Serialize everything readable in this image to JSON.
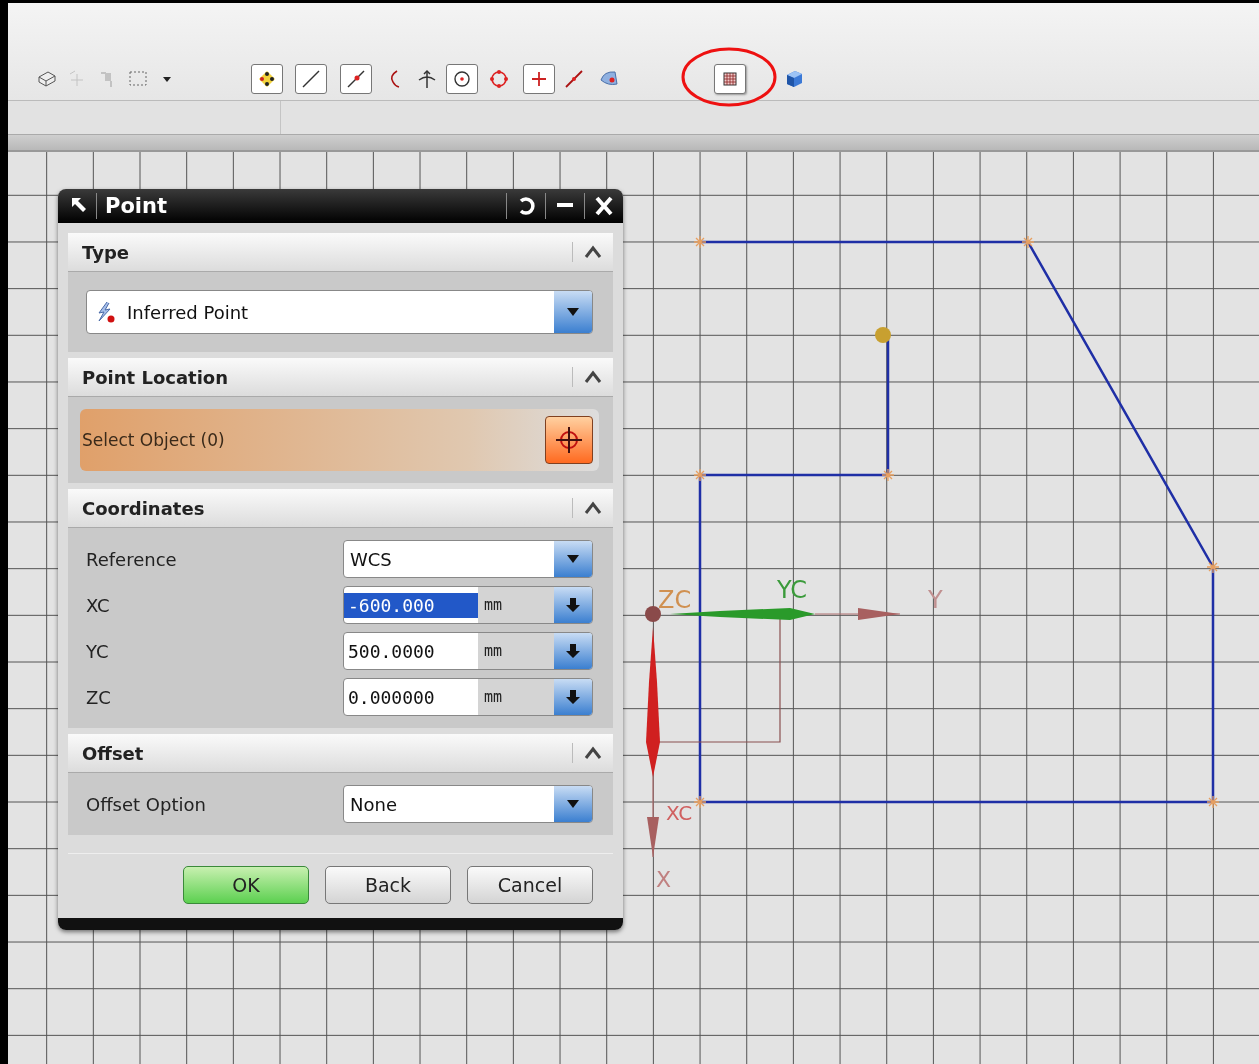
{
  "toolbar": {
    "buttons": [
      {
        "kind": "solid",
        "on": false,
        "disabled": false,
        "annotated": false
      },
      {
        "kind": "point-move",
        "on": false,
        "disabled": true,
        "annotated": false
      },
      {
        "kind": "pin",
        "on": false,
        "disabled": true,
        "annotated": false
      },
      {
        "kind": "select-box",
        "on": false,
        "disabled": false,
        "annotated": false
      },
      {
        "kind": "caret",
        "on": false,
        "disabled": false,
        "annotated": false
      },
      {
        "kind": "snap",
        "on": true,
        "disabled": false,
        "annotated": false
      },
      {
        "kind": "line",
        "on": true,
        "disabled": false,
        "annotated": false
      },
      {
        "kind": "endpoint",
        "on": true,
        "disabled": false,
        "annotated": false
      },
      {
        "kind": "arc",
        "on": false,
        "disabled": false,
        "annotated": false
      },
      {
        "kind": "intersect",
        "on": false,
        "disabled": false,
        "annotated": false
      },
      {
        "kind": "center",
        "on": true,
        "disabled": false,
        "annotated": false
      },
      {
        "kind": "quadrant",
        "on": false,
        "disabled": false,
        "annotated": false
      },
      {
        "kind": "plus",
        "on": true,
        "disabled": false,
        "annotated": false
      },
      {
        "kind": "segment",
        "on": false,
        "disabled": false,
        "annotated": false
      },
      {
        "kind": "face",
        "on": false,
        "disabled": false,
        "annotated": false
      },
      {
        "kind": "grid",
        "on": true,
        "disabled": false,
        "annotated": true
      },
      {
        "kind": "cube",
        "on": false,
        "disabled": false,
        "annotated": false
      }
    ]
  },
  "dialog": {
    "title": "Point",
    "sections": [
      {
        "title": "Type",
        "expanded": true,
        "rows": [
          {
            "kind": "type-select",
            "value": "Inferred Point"
          }
        ]
      },
      {
        "title": "Point Location",
        "expanded": true,
        "rows": [
          {
            "kind": "selection",
            "label": "Select Object (0)"
          }
        ]
      },
      {
        "title": "Coordinates",
        "expanded": true,
        "rows": [
          {
            "kind": "dropdown",
            "label": "Reference",
            "value": "WCS"
          },
          {
            "kind": "number",
            "label": "XC",
            "value": "-600.000",
            "unit": "mm",
            "selected": true
          },
          {
            "kind": "number",
            "label": "YC",
            "value": "500.0000",
            "unit": "mm",
            "selected": false
          },
          {
            "kind": "number",
            "label": "ZC",
            "value": "0.000000",
            "unit": "mm",
            "selected": false
          }
        ]
      },
      {
        "title": "Offset",
        "expanded": true,
        "rows": [
          {
            "kind": "dropdown",
            "label": "Offset Option",
            "value": "None"
          }
        ]
      }
    ],
    "buttons": [
      {
        "label": "OK",
        "default": true
      },
      {
        "label": "Back",
        "default": false
      },
      {
        "label": "Cancel",
        "default": false
      }
    ]
  },
  "canvas": {
    "axis_labels": {
      "zc": "ZC",
      "yc": "YC",
      "y": "Y",
      "xc": "XC",
      "x": "X"
    }
  }
}
